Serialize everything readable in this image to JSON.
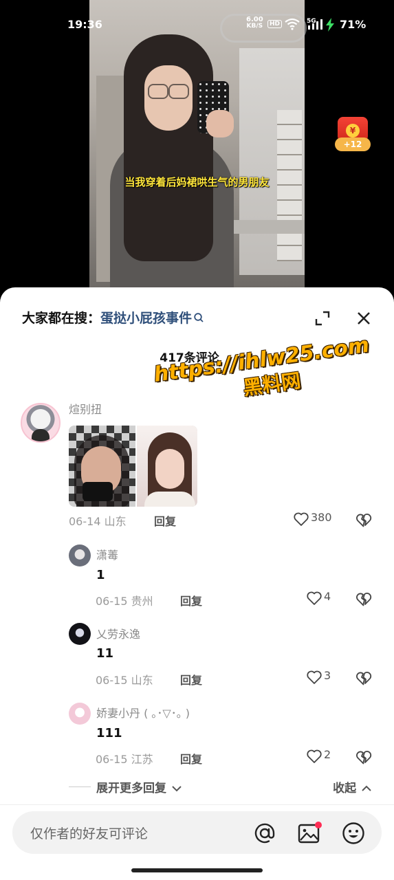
{
  "status_bar": {
    "time": "19:36",
    "net_speed": "6.00",
    "net_unit": "KB/S",
    "hd": "HD",
    "network": "5G",
    "battery": "71%"
  },
  "video": {
    "caption": "当我穿着后妈裙哄生气的男朋友"
  },
  "red_packet": {
    "coin": "¥",
    "badge": "+12"
  },
  "sheet": {
    "search_prefix": "大家都在搜：",
    "search_keyword": "蛋挞小屁孩事件",
    "comment_count": "417条评论",
    "watermark_url": "https://ihlw25.com",
    "watermark_cn": "黑料网"
  },
  "main_comment": {
    "user": "煊别扭",
    "date": "06-14 山东",
    "reply": "回复",
    "likes": "380"
  },
  "replies": [
    {
      "user": "潇䓯",
      "text": "1",
      "date": "06-15 贵州",
      "reply": "回复",
      "likes": "4"
    },
    {
      "user": "乂劳永逸",
      "text": "11",
      "date": "06-15 山东",
      "reply": "回复",
      "likes": "3"
    },
    {
      "user": "娇妻小丹 ( ｡･▽･｡ )",
      "text": "111",
      "date": "06-15 江苏",
      "reply": "回复",
      "likes": "2"
    }
  ],
  "more": {
    "expand": "展开更多回复",
    "collapse": "收起"
  },
  "input": {
    "placeholder": "仅作者的好友可评论"
  },
  "colors": {
    "caption": "#ffe63b",
    "keyword": "#2f4f7a",
    "watermark": "#ffb000",
    "notify_dot": "#ff2d55"
  }
}
